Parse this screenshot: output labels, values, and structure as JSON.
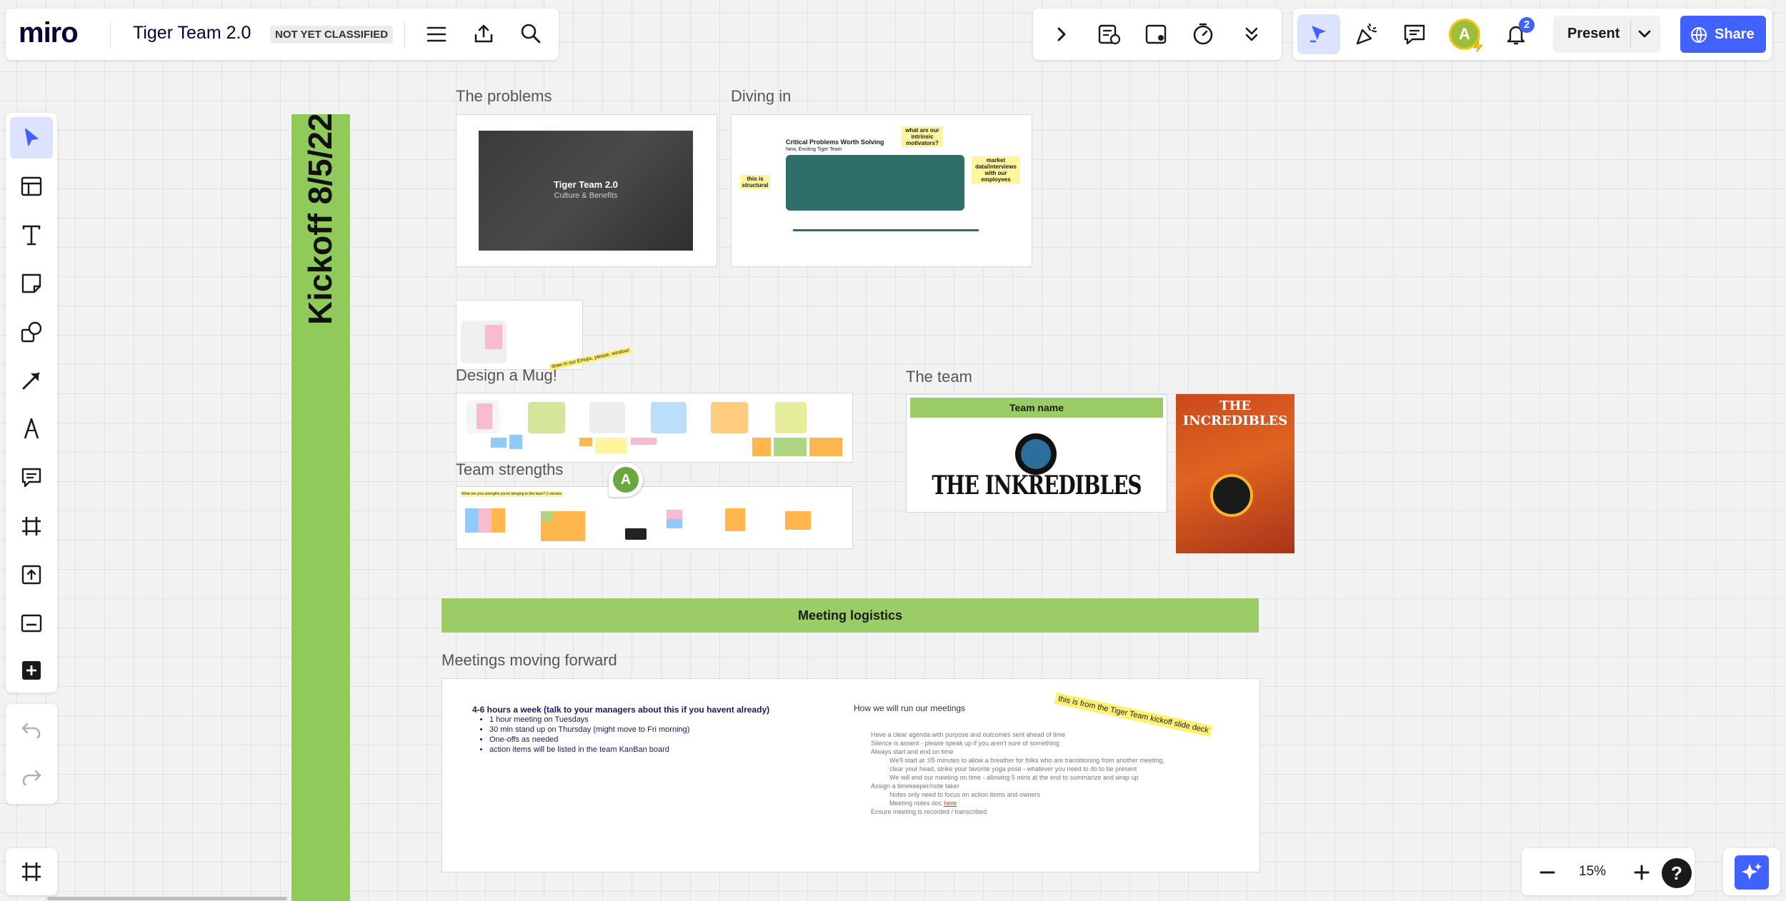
{
  "app": {
    "logo": "miro",
    "board_title": "Tiger Team 2.0",
    "classification": "NOT YET CLASSIFIED"
  },
  "toolbar_right": {
    "present_label": "Present",
    "share_label": "Share",
    "notification_count": "2",
    "avatar_letter": "A"
  },
  "zoom": {
    "level": "15%"
  },
  "left_tools": [
    "select-icon",
    "templates-icon",
    "text-icon",
    "sticky-note-icon",
    "shapes-icon",
    "pen-line-icon",
    "pen-icon",
    "comment-icon",
    "frame-icon",
    "upload-icon",
    "card-icon",
    "add-icon"
  ],
  "board": {
    "kickoff_banner": "Kickoff 8/5/22",
    "frames": {
      "problems": {
        "label": "The problems",
        "slide_title": "Tiger Team 2.0",
        "slide_subtitle": "Culture & Benefits"
      },
      "diving": {
        "label": "Diving in",
        "title": "Critical Problems Worth Solving",
        "subtitle": "New, Exciting Tiger Team",
        "note1": "this is structural",
        "note2": "what are our intrinsic motivators?",
        "note3": "market data/interviews with our employees"
      },
      "mug": {
        "label": "Design a Mug!",
        "annotation": "draw in our Emojis, please, window!"
      },
      "strengths": {
        "label": "Team strengths",
        "prompt": "What are your strengths you're bringing to this team? 2 minutes",
        "cursor_letter": "A"
      },
      "team": {
        "label": "The team",
        "header": "Team name",
        "logo_text": "THE INKREDIBLES",
        "poster_title": "THE INCREDIBLES"
      },
      "logistics": {
        "label": "Meeting logistics"
      },
      "meetings": {
        "label": "Meetings moving forward",
        "left_title": "4-6 hours a week (talk to your managers about this if you havent already)",
        "left_items": [
          "1 hour meeting on Tuesdays",
          "30 min stand up on Thursday (might move to Fri morning)",
          "One-offs as needed",
          "action items will be listed in the team KanBan board"
        ],
        "right_title": "How we will run our meetings",
        "sticker": "this is from the Tiger Team kickoff slide deck",
        "right_items": [
          "Have a clear agenda with purpose and outcomes sent ahead of time",
          "Silence is assent - please speak up if you aren't sure of something",
          "Always start and end on time",
          "We'll start at :05 minutes to allow a breather for folks who are transitioning from another meeting,",
          "clear your head, strike your favorite yoga pose - whatever you need to do to be present",
          "We will end our meeting on time - allowing 5 mins at the end to summarize and wrap up",
          "Assign a timekeeper/note taker",
          "Notes only need to focus on action items and owners",
          "Meeting notes doc",
          "Ensure meeting is recorded / transcribed"
        ],
        "link_text": "here"
      }
    }
  },
  "colors": {
    "accent": "#4262ff",
    "green": "#9ccc65",
    "banner_green": "#8fca5b",
    "toolbar_bg": "#ffffff"
  }
}
